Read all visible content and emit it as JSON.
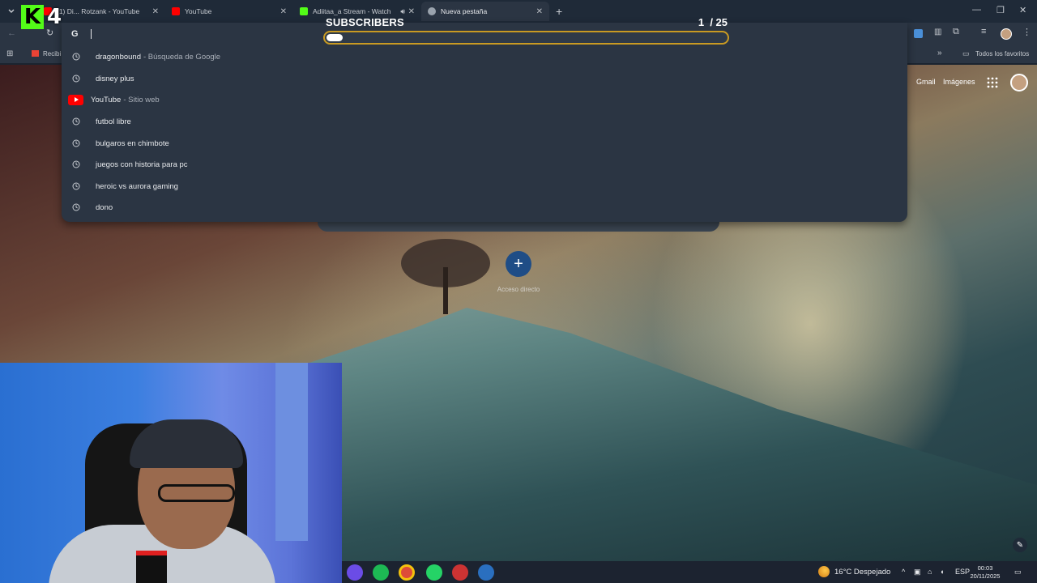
{
  "browser": {
    "tabs": [
      {
        "label": "(1) Di... Rotzank - YouTube",
        "icon": "youtube-icon"
      },
      {
        "label": "YouTube",
        "icon": "youtube-icon"
      },
      {
        "label": "Adiitaa_a Stream - Watch L...",
        "icon": "kick-icon"
      },
      {
        "label": "Nueva pestaña",
        "icon": "chrome-icon"
      }
    ],
    "bookmarks": {
      "first": "Recibi...",
      "all_favorites": "Todos los favoritos"
    }
  },
  "kick_overlay": {
    "logo_letter": "K",
    "count": "4"
  },
  "subscribers_goal": {
    "title": "SUBSCRIBERS",
    "current": "1",
    "goal": "/ 25",
    "progress": 0.04,
    "bar_color": "#c99a22"
  },
  "omnibox": {
    "engine_letter": "G",
    "suggestions": [
      {
        "text": "dragonbound",
        "suffix": "- Búsqueda de Google",
        "icon": "history-icon"
      },
      {
        "text": "disney plus",
        "suffix": "",
        "icon": "history-icon"
      },
      {
        "text": "YouTube",
        "suffix": "- Sitio web",
        "icon": "youtube-icon"
      },
      {
        "text": "futbol libre",
        "suffix": "",
        "icon": "history-icon"
      },
      {
        "text": "bulgaros en chimbote",
        "suffix": "",
        "icon": "history-icon"
      },
      {
        "text": "juegos con historia para pc",
        "suffix": "",
        "icon": "history-icon"
      },
      {
        "text": "heroic vs aurora gaming",
        "suffix": "",
        "icon": "history-icon"
      },
      {
        "text": "dono",
        "suffix": "",
        "icon": "history-icon"
      }
    ]
  },
  "newtab": {
    "gmail": "Gmail",
    "images": "Imágenes",
    "add_shortcut_label": "Acceso directo"
  },
  "taskbar": {
    "weather": "16°C Despejado",
    "lang": "ESP",
    "time": "00:03",
    "date": "20/11/2025"
  }
}
